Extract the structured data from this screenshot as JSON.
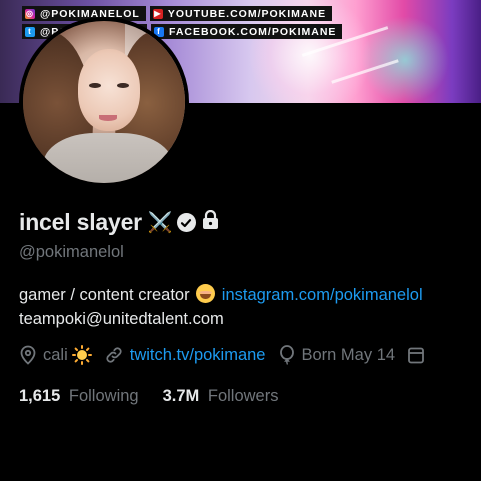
{
  "banner": {
    "socials": [
      {
        "icon": "instagram-icon",
        "label": "@POKIMANELOL"
      },
      {
        "icon": "youtube-icon",
        "label": "YOUTUBE.COM/POKIMANE"
      },
      {
        "icon": "twitter-icon",
        "label": "@POKIMANECOL"
      },
      {
        "icon": "facebook-icon",
        "label": "FACEBOOK.COM/POKIMANE"
      }
    ]
  },
  "profile": {
    "display_name": "incel slayer",
    "name_icons": [
      "crossed-swords-icon",
      "verified-badge-icon",
      "lock-icon"
    ],
    "handle": "@pokimanelol",
    "bio_line1_text": "gamer / content creator",
    "bio_line1_emoji": "smiling-face-icon",
    "bio_line1_link": "instagram.com/pokimanelol",
    "bio_line2": "teampoki@unitedtalent.com",
    "location": "cali",
    "location_emoji": "sun-icon",
    "website": "twitch.tv/pokimane",
    "birthday": "Born May 14",
    "following_count": "1,615",
    "following_label": "Following",
    "followers_count": "3.7M",
    "followers_label": "Followers"
  },
  "colors": {
    "background": "#000000",
    "text_primary": "#e7e9ea",
    "text_secondary": "#71767b",
    "link": "#1d9bf0"
  }
}
